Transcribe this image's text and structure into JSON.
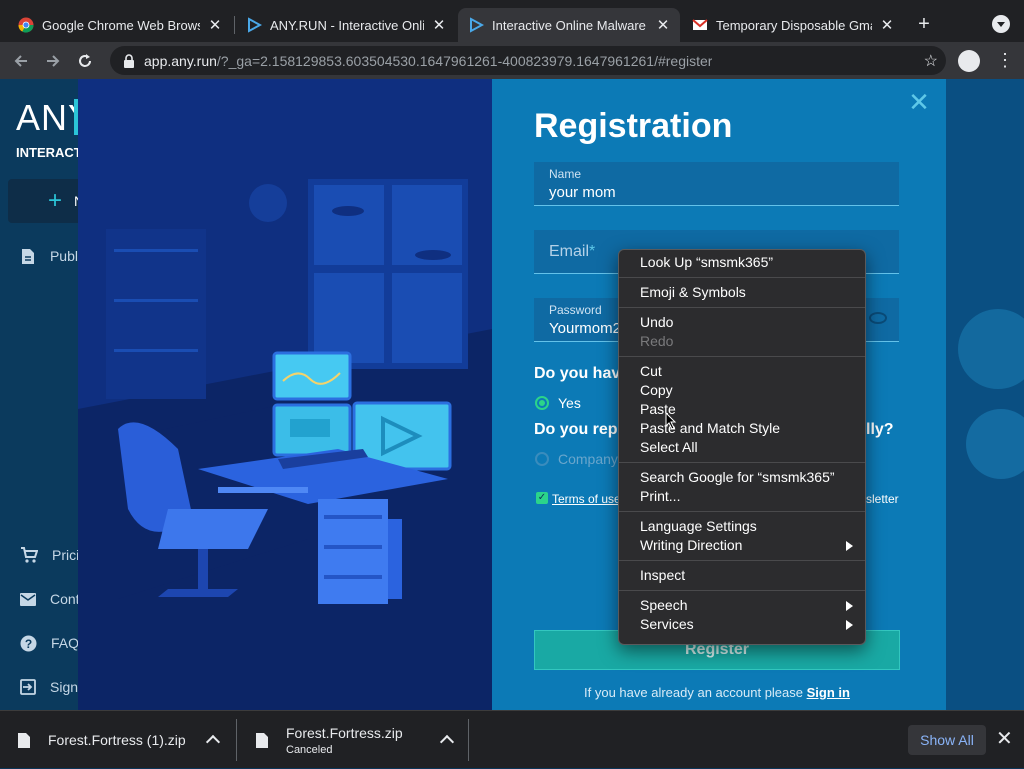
{
  "browser": {
    "tabs": [
      {
        "title": "Google Chrome Web Browser",
        "icon": "chrome-icon"
      },
      {
        "title": "ANY.RUN - Interactive Online Malware Sandbox",
        "icon": "anyrun-icon"
      },
      {
        "title": "Interactive Online Malware Analysis",
        "icon": "anyrun-icon"
      },
      {
        "title": "Temporary Disposable Gmail",
        "icon": "gmail-icon"
      }
    ],
    "active_tab": 2,
    "tab_close": "✕",
    "new_tab": "+",
    "url_host": "app.any.run",
    "url_rest": "/?_ga=2.158129853.603504530.1647961261-400823979.1647961261/#register"
  },
  "sidebar": {
    "logo": "ANY",
    "logo_sub": "INTERACTIVE",
    "new_task_label": "N",
    "items": [
      {
        "label": "Publ",
        "icon": "document-icon"
      },
      {
        "label": "Prici",
        "icon": "cart-icon"
      },
      {
        "label": "Cont",
        "icon": "mail-icon"
      },
      {
        "label": "FAQ",
        "icon": "help-icon"
      },
      {
        "label": "Sign",
        "icon": "signin-icon"
      }
    ]
  },
  "registration": {
    "title": "Registration",
    "name_label": "Name",
    "name_value": "your mom",
    "email_placeholder": "Email",
    "email_required_mark": "*",
    "password_label": "Password",
    "password_value": "Yourmom2",
    "question1": "Do you have",
    "option_yes": "Yes",
    "question2_start": "Do you repre",
    "question2_end": "lly?",
    "option_company": "Company",
    "terms_link": "Terms of use",
    "newsletter_tail": "sletter",
    "register_button": "Register",
    "signin_prompt": "If you have already an account please",
    "signin_link": "Sign in"
  },
  "context_menu": {
    "groups": [
      [
        {
          "label": "Look Up “smsmk365”"
        }
      ],
      [
        {
          "label": "Emoji & Symbols"
        }
      ],
      [
        {
          "label": "Undo"
        },
        {
          "label": "Redo",
          "disabled": true
        }
      ],
      [
        {
          "label": "Cut"
        },
        {
          "label": "Copy"
        },
        {
          "label": "Paste"
        },
        {
          "label": "Paste and Match Style"
        },
        {
          "label": "Select All"
        }
      ],
      [
        {
          "label": "Search Google for “smsmk365”"
        },
        {
          "label": "Print..."
        }
      ],
      [
        {
          "label": "Language Settings"
        },
        {
          "label": "Writing Direction",
          "submenu": true
        }
      ],
      [
        {
          "label": "Inspect"
        }
      ],
      [
        {
          "label": "Speech",
          "submenu": true
        },
        {
          "label": "Services",
          "submenu": true
        }
      ]
    ]
  },
  "downloads": {
    "items": [
      {
        "name": "Forest.Fortress (1).zip",
        "status": ""
      },
      {
        "name": "Forest.Fortress.zip",
        "status": "Canceled"
      }
    ],
    "show_all": "Show All",
    "close": "✕"
  },
  "colors": {
    "accent": "#2bc5d8",
    "form_bg": "#0c7ab6",
    "register_btn": "#19a9a4",
    "radio_on": "#2bd48a"
  }
}
